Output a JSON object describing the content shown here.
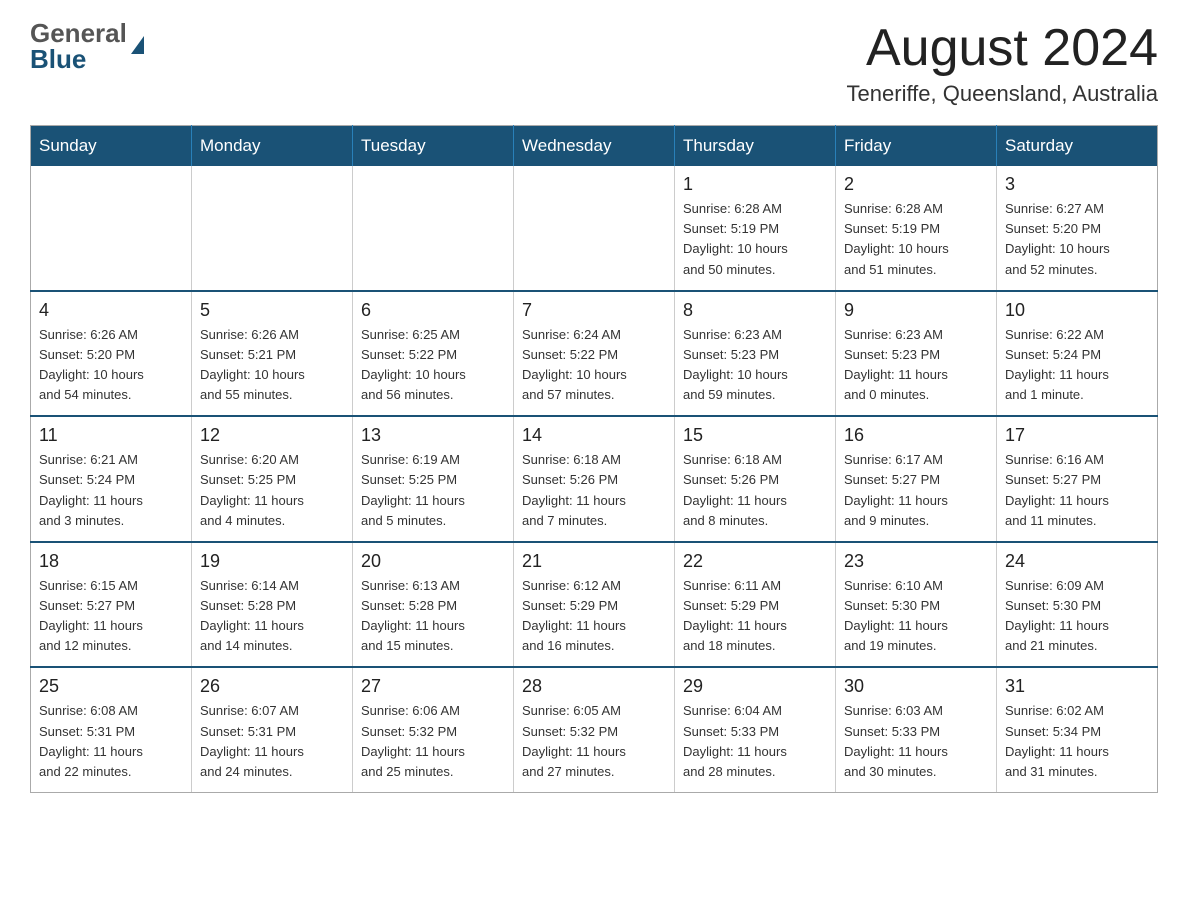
{
  "header": {
    "logo_general": "General",
    "logo_blue": "Blue",
    "title": "August 2024",
    "subtitle": "Teneriffe, Queensland, Australia"
  },
  "days_of_week": [
    "Sunday",
    "Monday",
    "Tuesday",
    "Wednesday",
    "Thursday",
    "Friday",
    "Saturday"
  ],
  "weeks": [
    [
      {
        "day": "",
        "info": ""
      },
      {
        "day": "",
        "info": ""
      },
      {
        "day": "",
        "info": ""
      },
      {
        "day": "",
        "info": ""
      },
      {
        "day": "1",
        "info": "Sunrise: 6:28 AM\nSunset: 5:19 PM\nDaylight: 10 hours\nand 50 minutes."
      },
      {
        "day": "2",
        "info": "Sunrise: 6:28 AM\nSunset: 5:19 PM\nDaylight: 10 hours\nand 51 minutes."
      },
      {
        "day": "3",
        "info": "Sunrise: 6:27 AM\nSunset: 5:20 PM\nDaylight: 10 hours\nand 52 minutes."
      }
    ],
    [
      {
        "day": "4",
        "info": "Sunrise: 6:26 AM\nSunset: 5:20 PM\nDaylight: 10 hours\nand 54 minutes."
      },
      {
        "day": "5",
        "info": "Sunrise: 6:26 AM\nSunset: 5:21 PM\nDaylight: 10 hours\nand 55 minutes."
      },
      {
        "day": "6",
        "info": "Sunrise: 6:25 AM\nSunset: 5:22 PM\nDaylight: 10 hours\nand 56 minutes."
      },
      {
        "day": "7",
        "info": "Sunrise: 6:24 AM\nSunset: 5:22 PM\nDaylight: 10 hours\nand 57 minutes."
      },
      {
        "day": "8",
        "info": "Sunrise: 6:23 AM\nSunset: 5:23 PM\nDaylight: 10 hours\nand 59 minutes."
      },
      {
        "day": "9",
        "info": "Sunrise: 6:23 AM\nSunset: 5:23 PM\nDaylight: 11 hours\nand 0 minutes."
      },
      {
        "day": "10",
        "info": "Sunrise: 6:22 AM\nSunset: 5:24 PM\nDaylight: 11 hours\nand 1 minute."
      }
    ],
    [
      {
        "day": "11",
        "info": "Sunrise: 6:21 AM\nSunset: 5:24 PM\nDaylight: 11 hours\nand 3 minutes."
      },
      {
        "day": "12",
        "info": "Sunrise: 6:20 AM\nSunset: 5:25 PM\nDaylight: 11 hours\nand 4 minutes."
      },
      {
        "day": "13",
        "info": "Sunrise: 6:19 AM\nSunset: 5:25 PM\nDaylight: 11 hours\nand 5 minutes."
      },
      {
        "day": "14",
        "info": "Sunrise: 6:18 AM\nSunset: 5:26 PM\nDaylight: 11 hours\nand 7 minutes."
      },
      {
        "day": "15",
        "info": "Sunrise: 6:18 AM\nSunset: 5:26 PM\nDaylight: 11 hours\nand 8 minutes."
      },
      {
        "day": "16",
        "info": "Sunrise: 6:17 AM\nSunset: 5:27 PM\nDaylight: 11 hours\nand 9 minutes."
      },
      {
        "day": "17",
        "info": "Sunrise: 6:16 AM\nSunset: 5:27 PM\nDaylight: 11 hours\nand 11 minutes."
      }
    ],
    [
      {
        "day": "18",
        "info": "Sunrise: 6:15 AM\nSunset: 5:27 PM\nDaylight: 11 hours\nand 12 minutes."
      },
      {
        "day": "19",
        "info": "Sunrise: 6:14 AM\nSunset: 5:28 PM\nDaylight: 11 hours\nand 14 minutes."
      },
      {
        "day": "20",
        "info": "Sunrise: 6:13 AM\nSunset: 5:28 PM\nDaylight: 11 hours\nand 15 minutes."
      },
      {
        "day": "21",
        "info": "Sunrise: 6:12 AM\nSunset: 5:29 PM\nDaylight: 11 hours\nand 16 minutes."
      },
      {
        "day": "22",
        "info": "Sunrise: 6:11 AM\nSunset: 5:29 PM\nDaylight: 11 hours\nand 18 minutes."
      },
      {
        "day": "23",
        "info": "Sunrise: 6:10 AM\nSunset: 5:30 PM\nDaylight: 11 hours\nand 19 minutes."
      },
      {
        "day": "24",
        "info": "Sunrise: 6:09 AM\nSunset: 5:30 PM\nDaylight: 11 hours\nand 21 minutes."
      }
    ],
    [
      {
        "day": "25",
        "info": "Sunrise: 6:08 AM\nSunset: 5:31 PM\nDaylight: 11 hours\nand 22 minutes."
      },
      {
        "day": "26",
        "info": "Sunrise: 6:07 AM\nSunset: 5:31 PM\nDaylight: 11 hours\nand 24 minutes."
      },
      {
        "day": "27",
        "info": "Sunrise: 6:06 AM\nSunset: 5:32 PM\nDaylight: 11 hours\nand 25 minutes."
      },
      {
        "day": "28",
        "info": "Sunrise: 6:05 AM\nSunset: 5:32 PM\nDaylight: 11 hours\nand 27 minutes."
      },
      {
        "day": "29",
        "info": "Sunrise: 6:04 AM\nSunset: 5:33 PM\nDaylight: 11 hours\nand 28 minutes."
      },
      {
        "day": "30",
        "info": "Sunrise: 6:03 AM\nSunset: 5:33 PM\nDaylight: 11 hours\nand 30 minutes."
      },
      {
        "day": "31",
        "info": "Sunrise: 6:02 AM\nSunset: 5:34 PM\nDaylight: 11 hours\nand 31 minutes."
      }
    ]
  ]
}
